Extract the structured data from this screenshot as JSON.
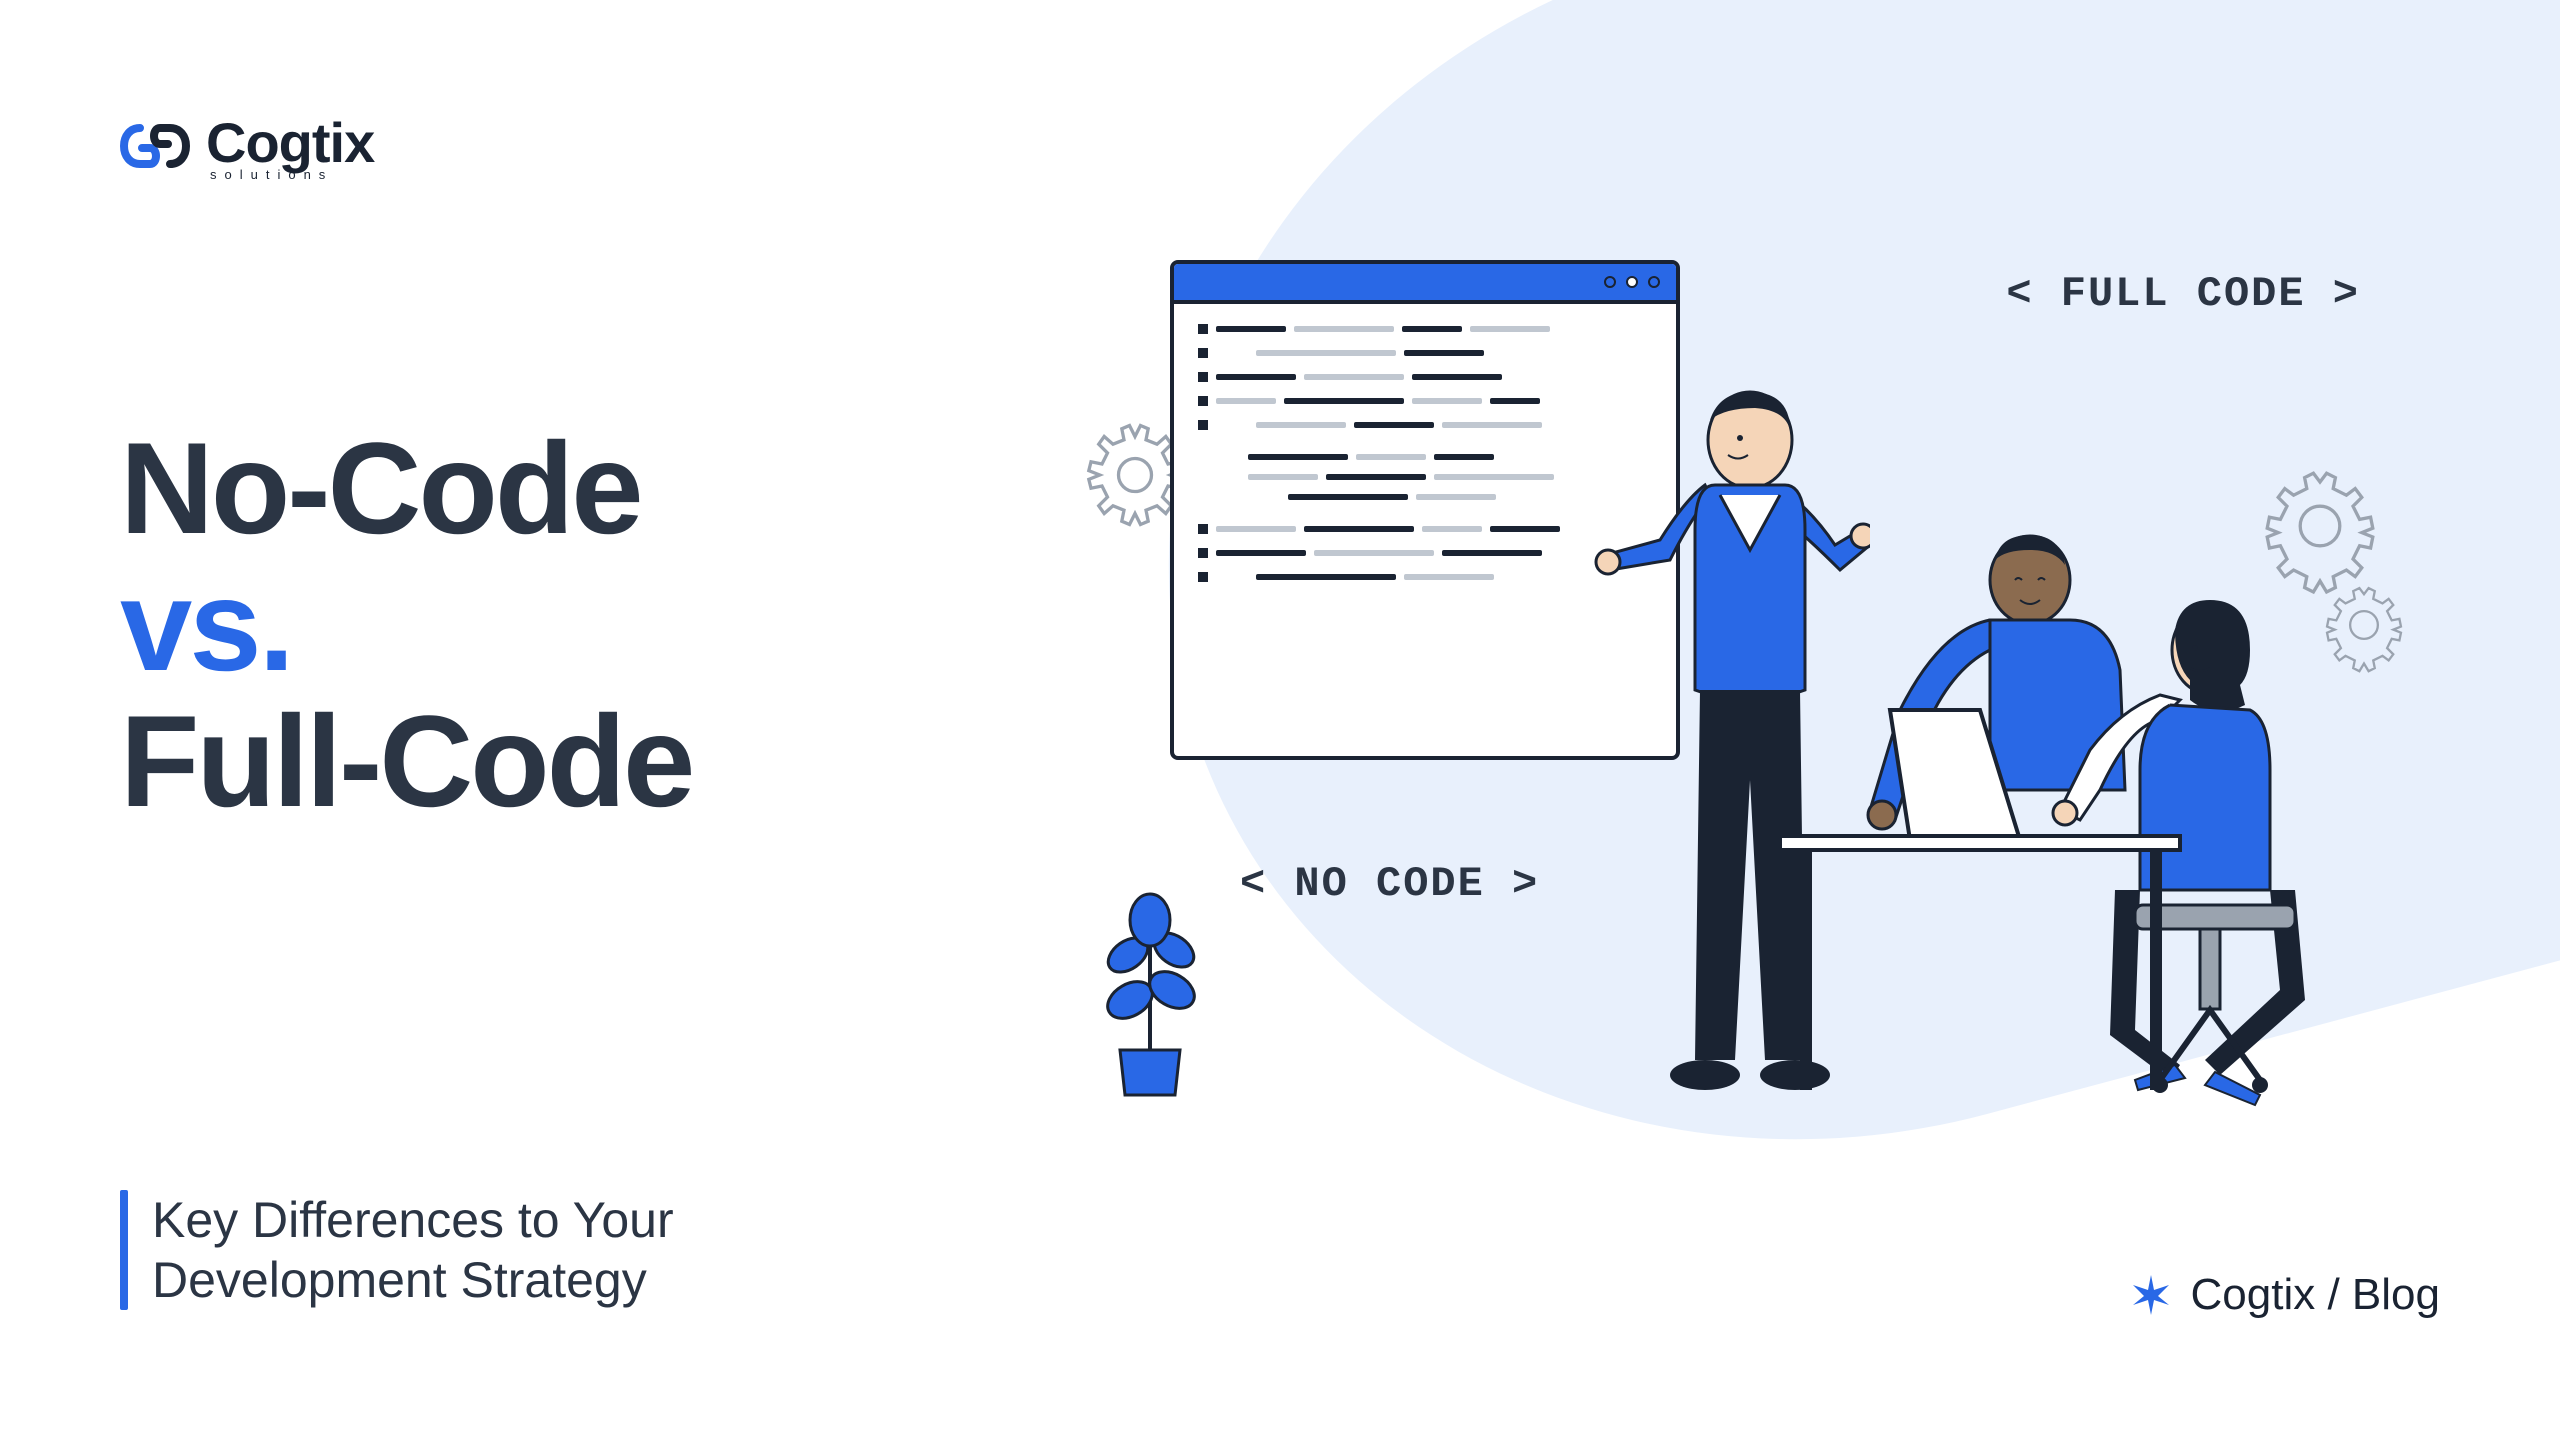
{
  "brand": {
    "name": "Cogtix",
    "tagline": "solutions"
  },
  "headline": {
    "line1": "No-Code",
    "vs": "vs.",
    "line2": "Full-Code"
  },
  "subtitle": {
    "line1": "Key Differences to Your",
    "line2": "Development Strategy"
  },
  "labels": {
    "no_code": "< NO CODE >",
    "full_code": "< FULL CODE >"
  },
  "footer": {
    "brand": "Cogtix",
    "section": "/ Blog"
  },
  "colors": {
    "primary_blue": "#2968e6",
    "dark": "#2b3544",
    "light_bg": "#e8f0fc"
  }
}
